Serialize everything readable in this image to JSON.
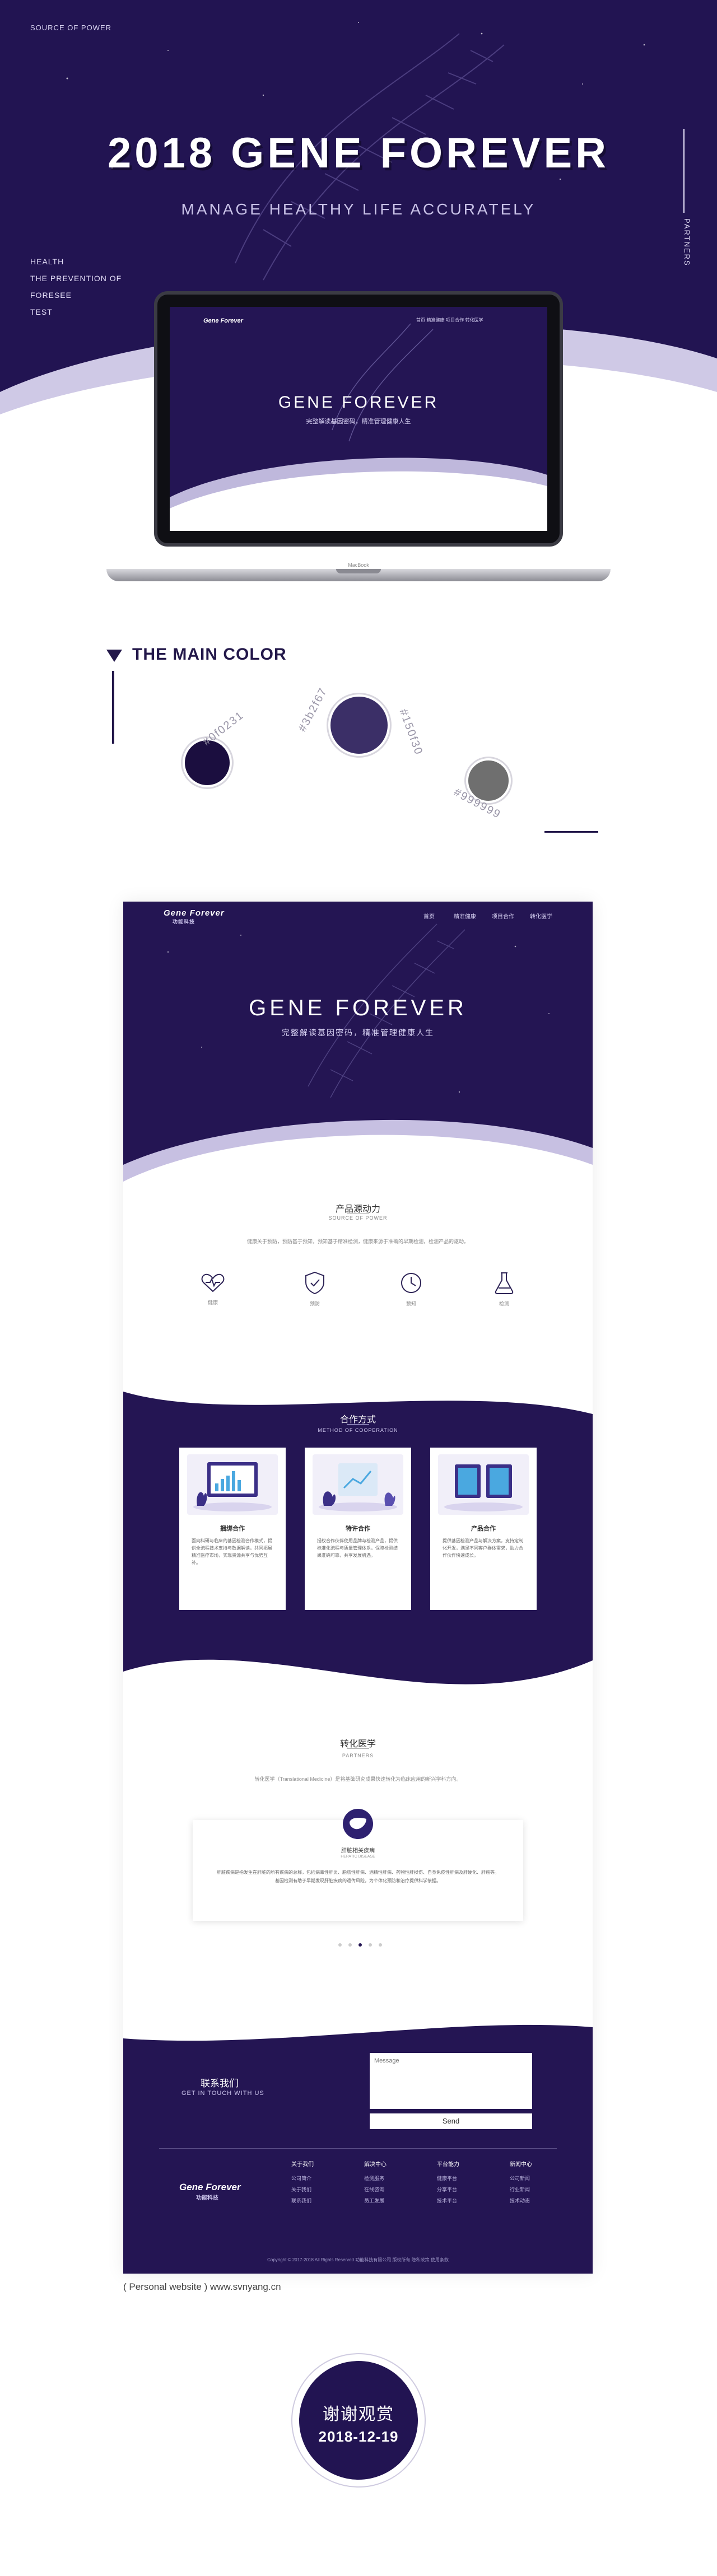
{
  "hero": {
    "tag_top": "SOURCE OF POWER",
    "title": "2018 GENE FOREVER",
    "subtitle": "MANAGE HEALTHY LIFE ACCURATELY",
    "side_list": [
      "HEALTH",
      "THE PREVENTION OF",
      "FORESEE",
      "TEST"
    ],
    "partners": "PARTNERS",
    "macbook": "MacBook"
  },
  "main_color": {
    "heading": "THE MAIN COLOR",
    "swatches": [
      {
        "hex": "#0f0231",
        "color": "#1b0e3f"
      },
      {
        "hex": "#3b2f67",
        "color": "#3b2f67"
      },
      {
        "hex": "#150f30",
        "color": "#150f30"
      },
      {
        "hex": "#999999",
        "color": "#6f6f6f"
      }
    ]
  },
  "site": {
    "logo": "Gene Forever",
    "logo_sub": "功能科技",
    "nav": [
      "首页",
      "精准健康",
      "项目合作",
      "转化医学"
    ],
    "title": "GENE FOREVER",
    "subtitle": "完整解读基因密码，精准管理健康人生",
    "power": {
      "title": "产品源动力",
      "sub": "SOURCE OF POWER",
      "intro": "健康关于预防，预防基于预知，预知基于精准检测，健康来源于准确的早期检测，检测产品的驱动。",
      "items": [
        "健康",
        "预防",
        "预知",
        "检测"
      ]
    },
    "coop": {
      "title": "合作方式",
      "sub": "METHOD OF COOPERATION",
      "cards": [
        {
          "title": "捆绑合作",
          "text": "面向科研与临床的基因检测合作模式，提供全流程技术支持与数据解读，共同拓展精准医疗市场，实现资源共享与优势互补。"
        },
        {
          "title": "特许合作",
          "text": "授权合作伙伴使用品牌与检测产品，提供标准化流程与质量管理体系，保障检测结果准确可靠，共享发展机遇。"
        },
        {
          "title": "产品合作",
          "text": "提供基因检测产品与解决方案，支持定制化开发，满足不同客户群体需求，助力合作伙伴快速成长。"
        }
      ]
    },
    "partners": {
      "title": "转化医学",
      "sub": "PARTNERS",
      "intro": "转化医学（Translational Medicine）是将基础研究成果快速转化为临床应用的新兴学科方向。",
      "card_title": "肝脏相关疾病",
      "card_sub": "HEPATIC DISEASE",
      "card_text": "肝脏疾病是指发生在肝脏的所有疾病的总称，包括病毒性肝炎、脂肪性肝病、酒精性肝病、药物性肝损伤、自身免疫性肝病及肝硬化、肝癌等。基因检测有助于早期发现肝脏疾病的遗传风险，为个体化预防和治疗提供科学依据。"
    },
    "footer": {
      "contact": "联系我们",
      "contact_sub": "GET IN TOUCH WITH US",
      "message_placeholder": "Message",
      "send": "Send",
      "columns": [
        {
          "title": "关于我们",
          "items": [
            "公司简介",
            "关于我们",
            "联系我们"
          ]
        },
        {
          "title": "解决中心",
          "items": [
            "检测服务",
            "在线咨询",
            "员工发展"
          ]
        },
        {
          "title": "平台能力",
          "items": [
            "健康平台",
            "分享平台",
            "技术平台"
          ]
        },
        {
          "title": "新闻中心",
          "items": [
            "公司新闻",
            "行业新闻",
            "技术动态"
          ]
        }
      ],
      "copyright": "Copyright © 2017-2018 All Rights Reserved 功能科技有限公司 版权所有 隐私政策 使用条款"
    }
  },
  "personal": "( Personal website )  www.svnyang.cn",
  "thanks": {
    "line1": "谢谢观赏",
    "line2": "2018-12-19"
  },
  "colors": {
    "brand_dark": "#221452",
    "accent": "#3b2f67"
  }
}
